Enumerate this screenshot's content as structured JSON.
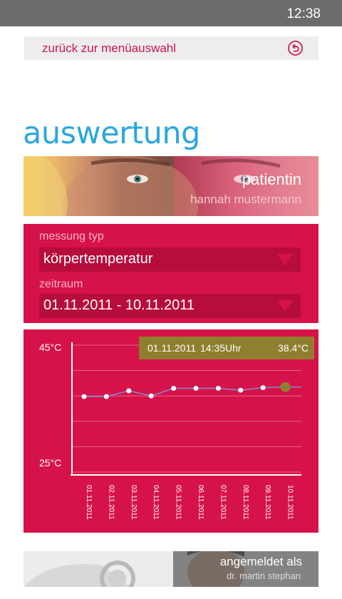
{
  "status_bar": {
    "time": "12:38"
  },
  "back": {
    "label": "zurück zur menüauswahl",
    "icon": "back-arrow-circle-icon"
  },
  "page": {
    "title": "auswertung"
  },
  "patient": {
    "role": "patientin",
    "name": "hannah mustermann"
  },
  "filters": {
    "measurement_type": {
      "label": "messung typ",
      "value": "körpertemperatur"
    },
    "period": {
      "label": "zeitraum",
      "value": "01.11.2011 - 10.11.2011"
    }
  },
  "tooltip": {
    "date": "01.11.2011",
    "time": "14:35Uhr",
    "value": "38.4°C"
  },
  "chart_data": {
    "type": "line",
    "categories": [
      "01.11.2011",
      "02.11.2011",
      "03.11.2011",
      "04.11.2011",
      "05.11.2011",
      "06.11.2011",
      "07.11.2011",
      "08.11.2011",
      "09.11.2011",
      "10.11.2011"
    ],
    "series": [
      {
        "values": [
          36.9,
          36.9,
          37.8,
          37.0,
          38.2,
          38.2,
          38.2,
          37.9,
          38.3,
          38.4
        ]
      }
    ],
    "y_tick_labels": [
      "45°C",
      "25°C"
    ],
    "ylim": [
      25,
      45
    ],
    "grid": true,
    "highlight_index": 9,
    "colors": {
      "background": "#d6124a",
      "line": "#7f8bd0",
      "point": "#ffffff",
      "highlight": "#8f7f2e",
      "grid": "#e86688"
    }
  },
  "footer": {
    "label": "angemeldet als",
    "user": "dr. martin stephan"
  }
}
